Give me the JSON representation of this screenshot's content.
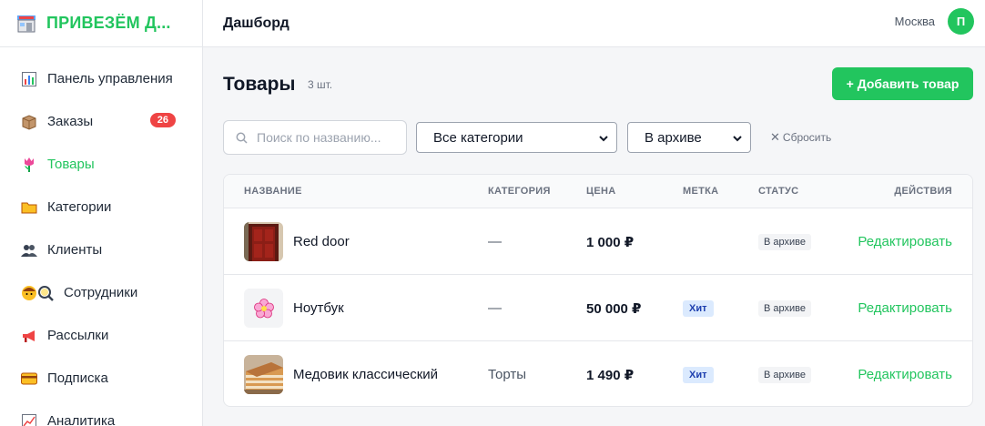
{
  "brand": {
    "name": "ПРИВЕЗЁМ Д...",
    "logo_icon": "store-icon"
  },
  "sidebar": {
    "items": [
      {
        "label": "Панель управления",
        "icon": "chart-icon",
        "active": false
      },
      {
        "label": "Заказы",
        "icon": "package-icon",
        "active": false,
        "badge": "26"
      },
      {
        "label": "Товары",
        "icon": "tulip-icon",
        "active": true
      },
      {
        "label": "Категории",
        "icon": "folder-icon",
        "active": false
      },
      {
        "label": "Клиенты",
        "icon": "users-icon",
        "active": false
      },
      {
        "label": "Сотрудники",
        "icon": "staff-icon",
        "active": false
      },
      {
        "label": "Рассылки",
        "icon": "megaphone-icon",
        "active": false
      },
      {
        "label": "Подписка",
        "icon": "card-icon",
        "active": false
      },
      {
        "label": "Аналитика",
        "icon": "trend-icon",
        "active": false
      }
    ]
  },
  "header": {
    "title": "Дашборд",
    "city": "Москва",
    "avatar_initial": "П"
  },
  "main": {
    "title": "Товары",
    "count": "3 шт.",
    "add_button": "+ Добавить товар",
    "search": {
      "placeholder": "Поиск по названию...",
      "value": ""
    },
    "category_filter": "Все категории",
    "archive_filter": "В архиве",
    "reset_label": "Сбросить"
  },
  "table": {
    "columns": [
      "НАЗВАНИЕ",
      "КАТЕГОРИЯ",
      "ЦЕНА",
      "МЕТКА",
      "СТАТУС",
      "ДЕЙСТВИЯ"
    ],
    "rows": [
      {
        "name": "Red door",
        "category": "—",
        "price": "1 000 ₽",
        "tag": "",
        "status": "В архиве",
        "action": "Редактировать",
        "thumb": "door-image"
      },
      {
        "name": "Ноутбук",
        "category": "—",
        "price": "50 000 ₽",
        "tag": "Хит",
        "status": "В архиве",
        "action": "Редактировать",
        "thumb": "flower-icon"
      },
      {
        "name": "Медовик классический",
        "category": "Торты",
        "price": "1 490 ₽",
        "tag": "Хит",
        "status": "В архиве",
        "action": "Редактировать",
        "thumb": "cake-image"
      }
    ]
  },
  "colors": {
    "accent": "#22c55e",
    "badge": "#ef4444",
    "tag_bg": "#dbeafe",
    "tag_text": "#1e40af"
  }
}
